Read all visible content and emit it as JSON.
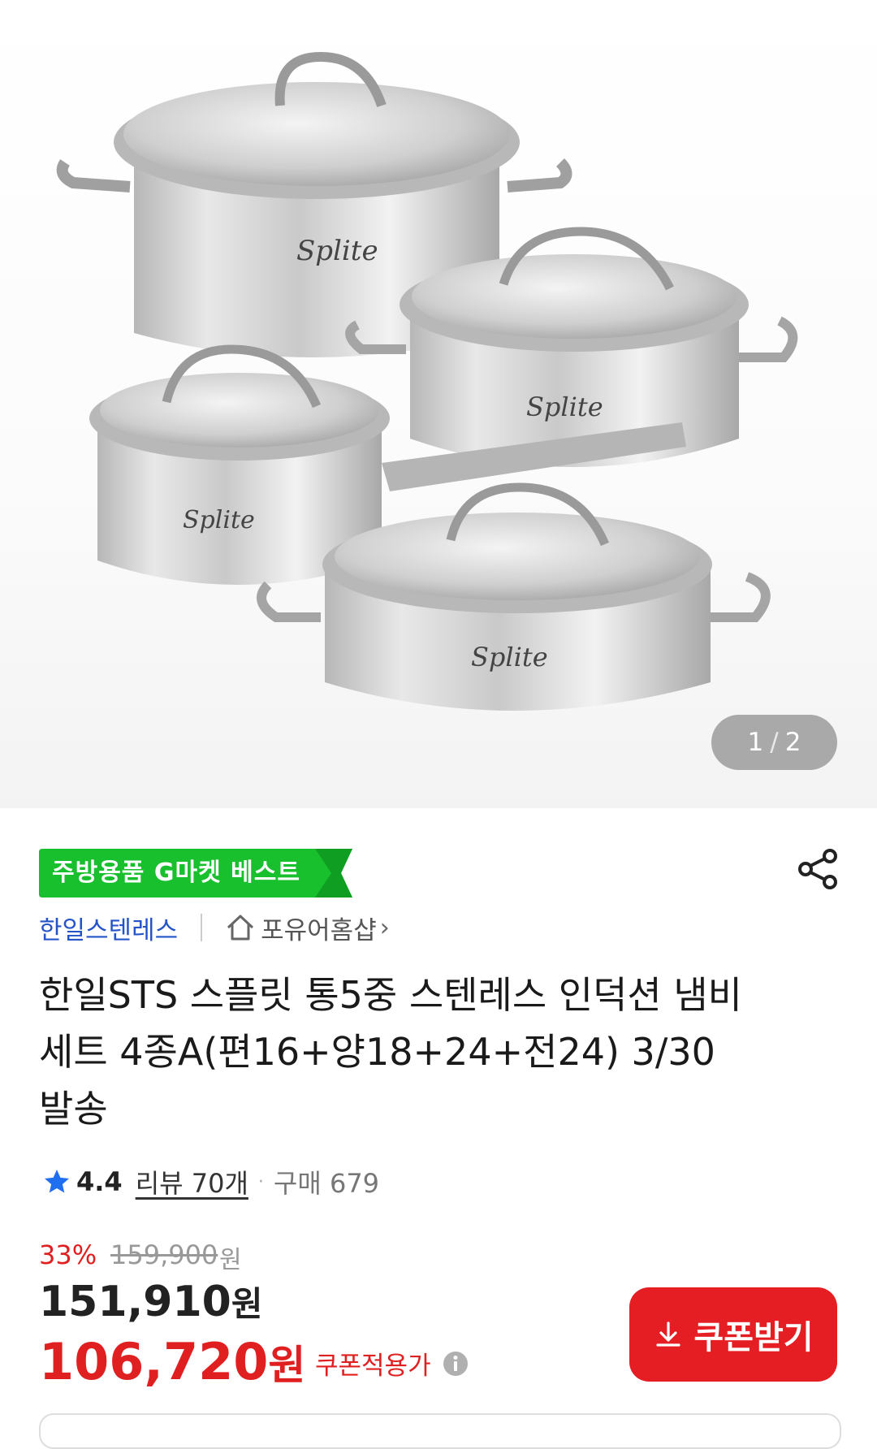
{
  "gallery": {
    "current_page": "1",
    "separator": "/",
    "total_pages": "2",
    "brand_mark": "Splite"
  },
  "badge": {
    "label": "주방용품 G마켓 베스트",
    "color": "#19c02e"
  },
  "seller": {
    "brand_name": "한일스텐레스",
    "shop_name": "포유어홈샵"
  },
  "product": {
    "title": "한일STS 스플릿 통5중 스텐레스 인덕션 냄비세트 4종A(편16+양18+24+전24) 3/30 발송"
  },
  "rating": {
    "score": "4.4",
    "reviews": "리뷰 70개",
    "separator": "·",
    "purchases": "구매 679"
  },
  "price": {
    "discount_rate": "33%",
    "original": "159,900",
    "original_unit": "원",
    "sale": "151,910",
    "sale_unit": "원",
    "coupon_price": "106,720",
    "coupon_unit": "원",
    "coupon_label": "쿠폰적용가"
  },
  "actions": {
    "coupon_button": "쿠폰받기"
  },
  "colors": {
    "accent_red": "#e51e23",
    "link_blue": "#2454c8",
    "star_blue": "#1f6ff0"
  }
}
